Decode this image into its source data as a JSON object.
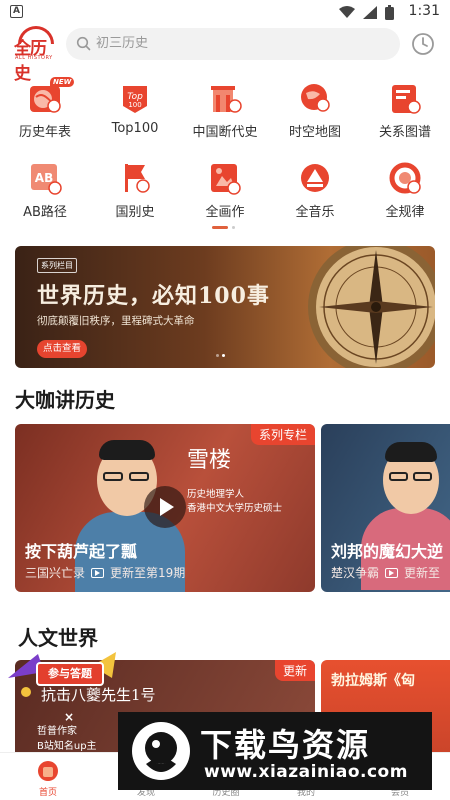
{
  "status_bar": {
    "time": "1:31",
    "app_badge": "A"
  },
  "header": {
    "logo": {
      "text": "全历史",
      "subtext": "ALL HISTORY"
    },
    "search": {
      "placeholder": "初三历史"
    }
  },
  "grid": {
    "items": [
      {
        "label": "历史年表",
        "icon": "timeline-globe-icon",
        "badge": "NEW"
      },
      {
        "label": "Top100",
        "icon": "top100-icon"
      },
      {
        "label": "中国断代史",
        "icon": "china-dynasty-icon"
      },
      {
        "label": "时空地图",
        "icon": "map-pin-icon"
      },
      {
        "label": "关系图谱",
        "icon": "relation-graph-icon"
      },
      {
        "label": "AB路径",
        "icon": "ab-path-icon"
      },
      {
        "label": "国别史",
        "icon": "country-flag-icon"
      },
      {
        "label": "全画作",
        "icon": "painting-icon"
      },
      {
        "label": "全音乐",
        "icon": "music-icon"
      },
      {
        "label": "全规律",
        "icon": "pattern-icon"
      }
    ]
  },
  "banner": {
    "tag": "系列栏目",
    "title": "世界历史，必知100事",
    "subtitle": "彻底颠覆旧秩序，里程碑式大革命",
    "button": "点击查看"
  },
  "section1": {
    "title": "大咖讲历史",
    "cards": [
      {
        "corner": "系列专栏",
        "name": "雪楼",
        "desc1": "历史地理学人",
        "desc2": "香港中文大学历史硕士",
        "title": "按下葫芦起了瓢",
        "category": "三国兴亡录",
        "update": "更新至第19期"
      },
      {
        "title": "刘邦的魔幻大逆",
        "category": "楚汉争霸",
        "update": "更新至"
      }
    ]
  },
  "section2": {
    "title": "人文世界",
    "cards": [
      {
        "corner": "更新",
        "title": "抗击八夔先生1号",
        "line1": "哲普作家",
        "line2": "B站知名up主"
      },
      {
        "title": "勃拉姆斯《匈"
      }
    ]
  },
  "quiz": {
    "label": "参与答题",
    "close": "×"
  },
  "bottom_nav": {
    "items": [
      {
        "label": "首页",
        "icon": "home-icon"
      },
      {
        "label": "发现",
        "icon": "discover-icon"
      },
      {
        "label": "历史圈",
        "icon": "circle-icon"
      },
      {
        "label": "我的",
        "icon": "profile-icon"
      },
      {
        "label": "会员",
        "icon": "vip-icon"
      }
    ]
  },
  "watermark": {
    "title": "下载鸟资源",
    "url": "www.xiazainiao.com"
  },
  "colors": {
    "accent": "#e8452f",
    "brand": "#d9322a"
  }
}
